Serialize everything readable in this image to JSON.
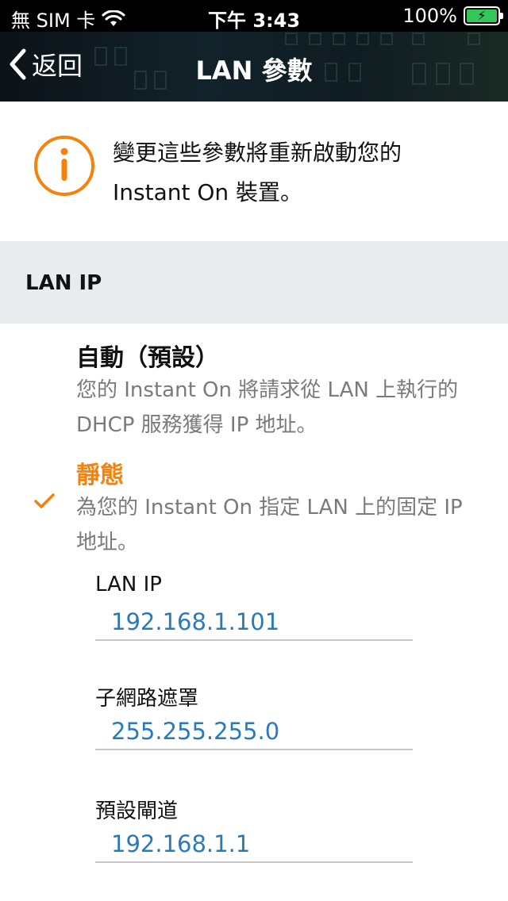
{
  "status_bar": {
    "carrier": "無 SIM 卡",
    "time": "下午 3:43",
    "battery": "100%",
    "icons": [
      "wifi-icon",
      "battery-charging-icon"
    ]
  },
  "nav": {
    "back_label": "返回",
    "title": "LAN 參數"
  },
  "info_banner": {
    "icon": "info-icon",
    "text": "變更這些參數將重新啟動您的 Instant On 裝置。",
    "accent_color": "#f5820d"
  },
  "section": {
    "title": "LAN IP"
  },
  "options": {
    "auto": {
      "title": "自動（預設）",
      "description": "您的 Instant On 將請求從 LAN 上執行的 DHCP 服務獲得 IP 地址。",
      "selected": false
    },
    "static": {
      "title": "靜態",
      "description": "為您的 Instant On 指定 LAN 上的固定 IP 地址。",
      "selected": true
    }
  },
  "fields": {
    "lan_ip": {
      "label": "LAN IP",
      "value": "192.168.1.101"
    },
    "subnet_mask": {
      "label": "子網路遮罩",
      "value": "255.255.255.0"
    },
    "gateway": {
      "label": "預設閘道",
      "value": "192.168.1.1"
    }
  },
  "colors": {
    "accent": "#f5820d",
    "link_value": "#2a7ab8",
    "section_bg": "#e9ecef"
  }
}
